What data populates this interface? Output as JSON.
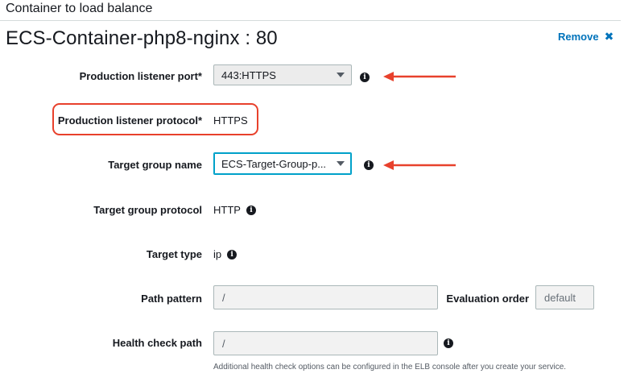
{
  "section": {
    "title": "Container to load balance"
  },
  "container": {
    "title": "ECS-Container-php8-nginx : 80",
    "remove_label": "Remove"
  },
  "fields": {
    "listener_port": {
      "label": "Production listener port*",
      "value": "443:HTTPS"
    },
    "listener_protocol": {
      "label": "Production listener protocol*",
      "value": "HTTPS"
    },
    "target_group_name": {
      "label": "Target group name",
      "value": "ECS-Target-Group-p..."
    },
    "target_group_protocol": {
      "label": "Target group protocol",
      "value": "HTTP"
    },
    "target_type": {
      "label": "Target type",
      "value": "ip"
    },
    "path_pattern": {
      "label": "Path pattern",
      "value": "/"
    },
    "evaluation_order": {
      "label": "Evaluation order",
      "placeholder": "default"
    },
    "health_check_path": {
      "label": "Health check path",
      "value": "/",
      "help": "Additional health check options can be configured in the ELB console after you create your service."
    }
  },
  "colors": {
    "annotation": "#e8412c",
    "link": "#0073bb",
    "focus": "#00a1c9"
  },
  "icons": {
    "info": "info-icon",
    "remove": "close-icon",
    "dropdown": "chevron-down-icon"
  }
}
